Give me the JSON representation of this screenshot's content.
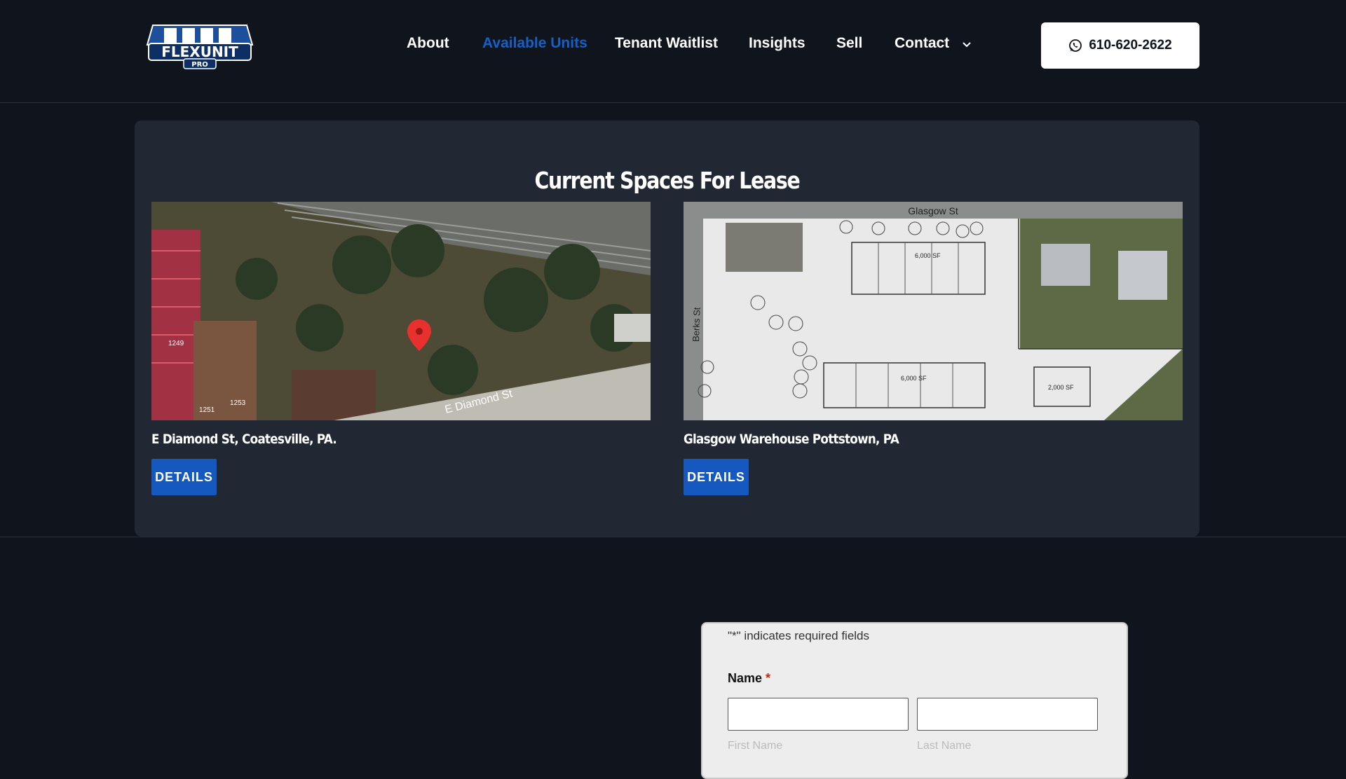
{
  "brand": {
    "logo_text": "FLEXUNIT",
    "logo_sub": "PRO"
  },
  "nav": {
    "items": [
      {
        "label": "About",
        "active": false
      },
      {
        "label": "Available Units",
        "active": true
      },
      {
        "label": "Tenant Waitlist",
        "active": false
      },
      {
        "label": "Insights",
        "active": false
      },
      {
        "label": "Sell",
        "active": false
      },
      {
        "label": "Contact",
        "active": false,
        "has_dropdown": true
      }
    ],
    "phone_label": "610-620-2622",
    "phone_icon": "whatsapp-icon"
  },
  "listings": {
    "title": "Current Spaces For Lease",
    "cards": [
      {
        "title": "E Diamond St, Coatesville, PA.",
        "button": "DETAILS",
        "map_labels": {
          "street": "E Diamond St",
          "n1": "1249",
          "n2": "1253",
          "n3": "1251"
        }
      },
      {
        "title": "Glasgow Warehouse Pottstown, PA",
        "button": "DETAILS",
        "map_labels": {
          "street_top": "Glasgow St",
          "street_side": "Berks St",
          "bldg_a": "6,000 SF",
          "bldg_b": "6,000 SF",
          "bldg_c": "2,000 SF"
        }
      }
    ]
  },
  "form": {
    "required_note_quote": "\"*\"",
    "required_note_text": " indicates required fields",
    "name_label": "Name",
    "required_mark": "*",
    "first_name": "First Name",
    "last_name": "Last Name"
  },
  "colors": {
    "background": "#10141d",
    "panel": "#222833",
    "accent": "#1458c0",
    "active_nav": "#1560c8"
  }
}
